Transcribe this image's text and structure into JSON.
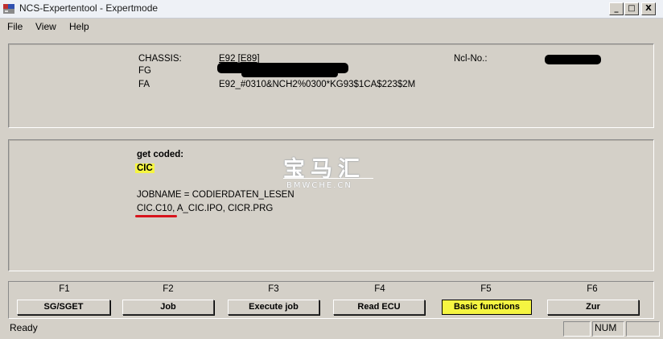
{
  "window": {
    "title": "NCS-Expertentool - Expertmode"
  },
  "titlebar_buttons": {
    "minimize": "_",
    "maximize": "□",
    "close": "X"
  },
  "menu": {
    "items": [
      "File",
      "View",
      "Help"
    ]
  },
  "info_panel": {
    "chassis_label": "CHASSIS:",
    "chassis_value": "E92 [E89]",
    "fg_label": "FG",
    "fa_label": "FA",
    "fa_value": "E92_#0310&NCH2%0300*KG93$1CA$223$2M",
    "ncl_label": "Ncl-No.:"
  },
  "result_panel": {
    "get_coded_label": "get coded:",
    "module": "CIC",
    "jobname_line": "JOBNAME = CODIERDATEN_LESEN",
    "file_highlight": "CIC.C10",
    "file_rest": ", A_CIC.IPO, CICR.PRG"
  },
  "watermark": {
    "chinese": "宝马汇",
    "domain": "BMWCHE.CN"
  },
  "function_keys": [
    {
      "key": "F1",
      "label": "SG/SGET",
      "active": false
    },
    {
      "key": "F2",
      "label": "Job",
      "active": false
    },
    {
      "key": "F3",
      "label": "Execute job",
      "active": false
    },
    {
      "key": "F4",
      "label": "Read ECU",
      "active": false
    },
    {
      "key": "F5",
      "label": "Basic functions",
      "active": true
    },
    {
      "key": "F6",
      "label": "Zur",
      "active": false
    }
  ],
  "status": {
    "text": "Ready",
    "num": "NUM"
  },
  "colors": {
    "highlight": "#f5f542",
    "underline": "#d8141c",
    "face": "#d4d0c8"
  }
}
